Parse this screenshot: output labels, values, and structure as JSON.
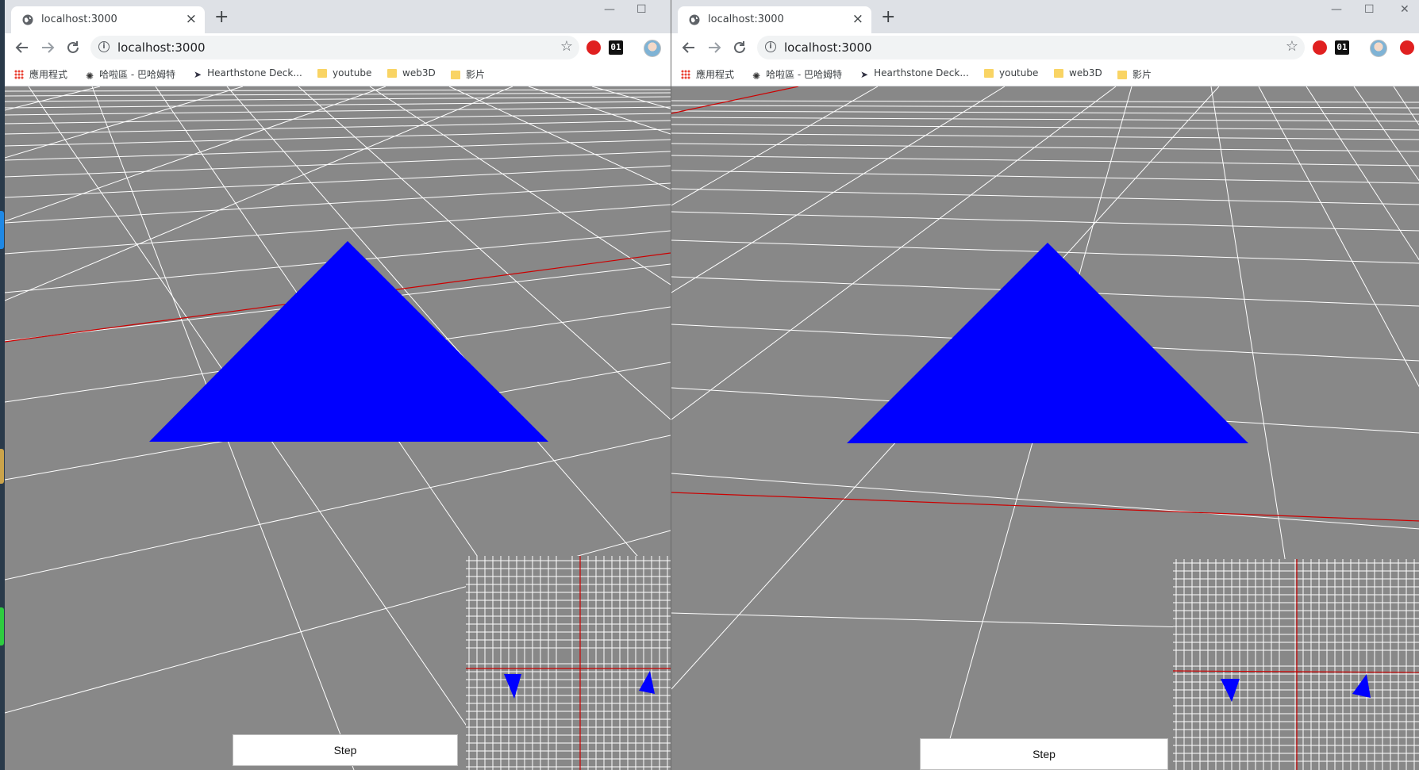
{
  "windows": [
    {
      "id": "left",
      "tab_title": "localhost:3000",
      "tab_close": "×",
      "new_tab": "+",
      "address": "localhost:3000",
      "bookmarks": [
        "應用程式",
        "哈啦區 - 巴哈姆特",
        "Hearthstone Deck...",
        "youtube",
        "web3D",
        "影片"
      ],
      "step_label": "Step"
    },
    {
      "id": "right",
      "tab_title": "localhost:3000",
      "tab_close": "×",
      "new_tab": "+",
      "address": "localhost:3000",
      "bookmarks": [
        "應用程式",
        "哈啦區 - 巴哈姆特",
        "Hearthstone Deck...",
        "youtube",
        "web3D",
        "影片"
      ],
      "step_label": "Step"
    }
  ],
  "toolbar_icons": [
    "back-arrow-icon",
    "forward-arrow-icon",
    "reload-icon",
    "info-icon",
    "star-icon"
  ],
  "extensions": [
    "opera-red-icon",
    "binary-01-icon",
    "profile-avatar"
  ],
  "window_controls": [
    "minimize-icon",
    "maximize-icon",
    "close-icon"
  ],
  "scene": {
    "background_color": "#888888",
    "grid_line_color": "#ffffff",
    "axis_line_color": "#cc0000",
    "triangle_color": "#0000ff"
  }
}
